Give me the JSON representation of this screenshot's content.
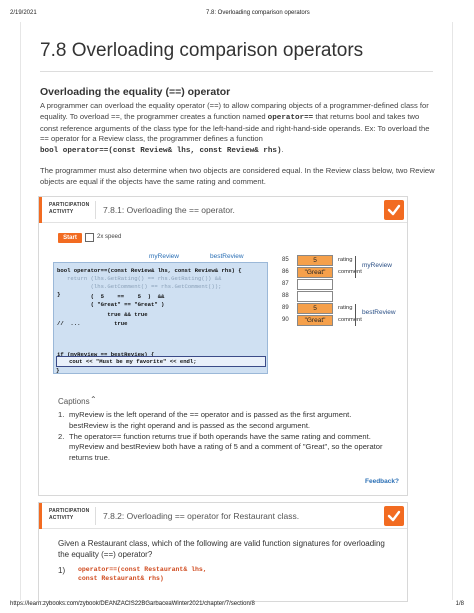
{
  "print": {
    "date": "2/19/2021",
    "header_title": "7.8: Overloading comparison operators",
    "footer_url": "https://learn.zybooks.com/zybook/DEANZACIS22BGarbaceaWinter2021/chapter/7/section/8",
    "footer_page": "1/8"
  },
  "page": {
    "title": "7.8 Overloading comparison operators",
    "section_heading": "Overloading the equality (==) operator",
    "para1_a": "A programmer can overload the equality operator (==) to allow comparing objects of a programmer-defined class for equality. To overload ==, the programmer creates a function named ",
    "para1_code1": "operator==",
    "para1_b": " that returns bool and takes two const reference arguments of the class type for the left-hand-side and right-hand-side operands. Ex: To overload the == operator for a Review class, the programmer defines a function",
    "para1_code2": "bool operator==(const Review& lhs, const Review& rhs)",
    "para1_c": ".",
    "para2": "The programmer must also determine when two objects are considered equal. In the Review class below, two Review objects are equal if the objects have the same rating and comment."
  },
  "activity1": {
    "label_line1": "PARTICIPATION",
    "label_line2": "ACTIVITY",
    "title": "7.8.1: Overloading the == operator.",
    "start_label": "Start",
    "speed_label": "2x speed",
    "obj_left": "myReview",
    "obj_right": "bestReview",
    "code": [
      "bool operator==(const Review& lhs, const Review& rhs) {",
      "   return (lhs.GetRating() == rhs.GetRating()) &&",
      "          (lhs.GetComment() == rhs.GetComment());",
      "}",
      "          (  5    ==    5  )  &&",
      "          ( \"Great\" == \"Great\" )",
      "               true && true",
      "//  ...          true",
      "if (myReview == bestReview) {",
      "   cout << \"Must be my favorite\" << endl;",
      "}"
    ],
    "memory": [
      {
        "addr": "85",
        "value": "5",
        "side": "rating"
      },
      {
        "addr": "86",
        "value": "\"Great\"",
        "side": "comment"
      },
      {
        "addr": "87",
        "value": "",
        "side": ""
      },
      {
        "addr": "88",
        "value": "",
        "side": ""
      },
      {
        "addr": "89",
        "value": "5",
        "side": "rating"
      },
      {
        "addr": "90",
        "value": "\"Great\"",
        "side": "comment"
      }
    ],
    "mem_group_top": "myReview",
    "mem_group_bottom": "bestReview",
    "captions_heading": "Captions",
    "captions": [
      "myReview is the left operand of the == operator and is passed as the first argument. bestReview is the right operand and is passed as the second argument.",
      "The operator== function returns true if both operands have the same rating and comment. myReview and bestReview both have a rating of 5 and a comment of \"Great\", so the operator returns true."
    ],
    "feedback": "Feedback?"
  },
  "activity2": {
    "label_line1": "PARTICIPATION",
    "label_line2": "ACTIVITY",
    "title": "7.8.2: Overloading == operator for Restaurant class.",
    "question": "Given a Restaurant class, which of the following are valid function signatures for overloading the equality (==) operator?",
    "option1_num": "1)",
    "option1_line1": "operator==(const Restaurant& lhs,",
    "option1_line2": "const Restaurant& rhs)"
  },
  "colors": {
    "accent": "#f26b21",
    "link": "#2a6fb5",
    "code_bg": "#cfe0f2"
  }
}
